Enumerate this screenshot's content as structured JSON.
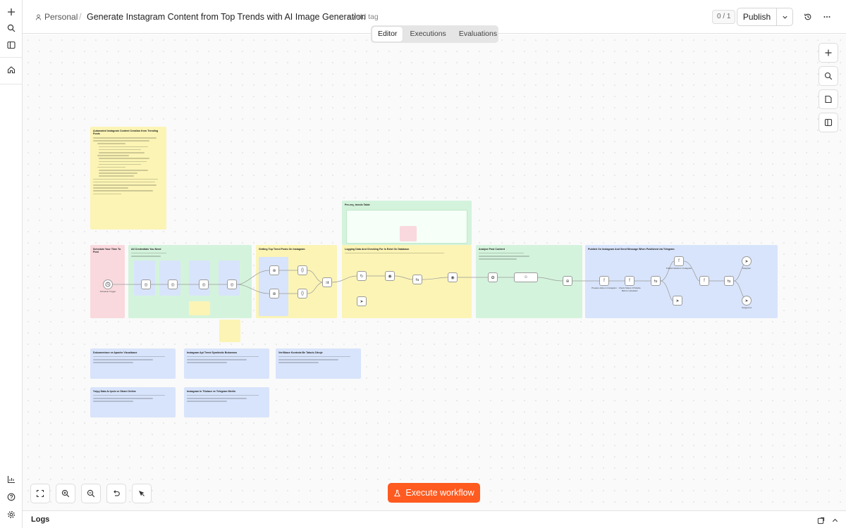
{
  "header": {
    "project": "Personal",
    "separator": "/",
    "workflow_title": "Generate Instagram Content from Top Trends with AI Image Generation",
    "add_tag": "+ Add tag",
    "counter": "0 / 1",
    "publish_label": "Publish"
  },
  "tabs": [
    {
      "label": "Editor",
      "active": true
    },
    {
      "label": "Executions",
      "active": false
    },
    {
      "label": "Evaluations",
      "active": false
    }
  ],
  "canvas": {
    "overview_title": "Automated Instagram Content Creation from Trending Posts",
    "sections": [
      {
        "title": "Schedule Your Time To Post"
      },
      {
        "title": "All Credentials You Need"
      },
      {
        "title": "Getting Top Trend Posts On Instagram"
      },
      {
        "title": "Logging Data And Checking For Is Exist On Database"
      },
      {
        "title": "Analyze Post Content"
      },
      {
        "title": "Publish On Instagram And Send Message When Published via Telegram"
      },
      {
        "title": "Pre-req_trends Table"
      }
    ],
    "nodes": {
      "schedule": "Schedule Trigger",
      "publish_instagram": "Prepare data on Instagram",
      "check_status": "Check Status Of Media Before Uploaded",
      "publish_media": "Publish Media to Instagram",
      "telegram_success": "Telegram",
      "telegram_fail": "Telegram1"
    },
    "docs": [
      {
        "title": "Dokumentace ve Apache Vizualizace"
      },
      {
        "title": "Instagram Api Trend Symbiotic Bukannos"
      },
      {
        "title": "Verifikace Kontrola Be Tabulo Zdroje"
      },
      {
        "title": "Ysipy Data Ar Ipolz ve Strani Online"
      },
      {
        "title": "Instagram In Titulace ve Telegram Merlin"
      }
    ]
  },
  "footer": {
    "execute_label": "Execute workflow",
    "logs_label": "Logs"
  },
  "colors": {
    "accent": "#ff5a1f",
    "note_yellow": "#fbf4b5",
    "note_pink": "#f9d9dd",
    "note_green": "#d4f3dc",
    "note_blue": "#d8e4fb"
  }
}
